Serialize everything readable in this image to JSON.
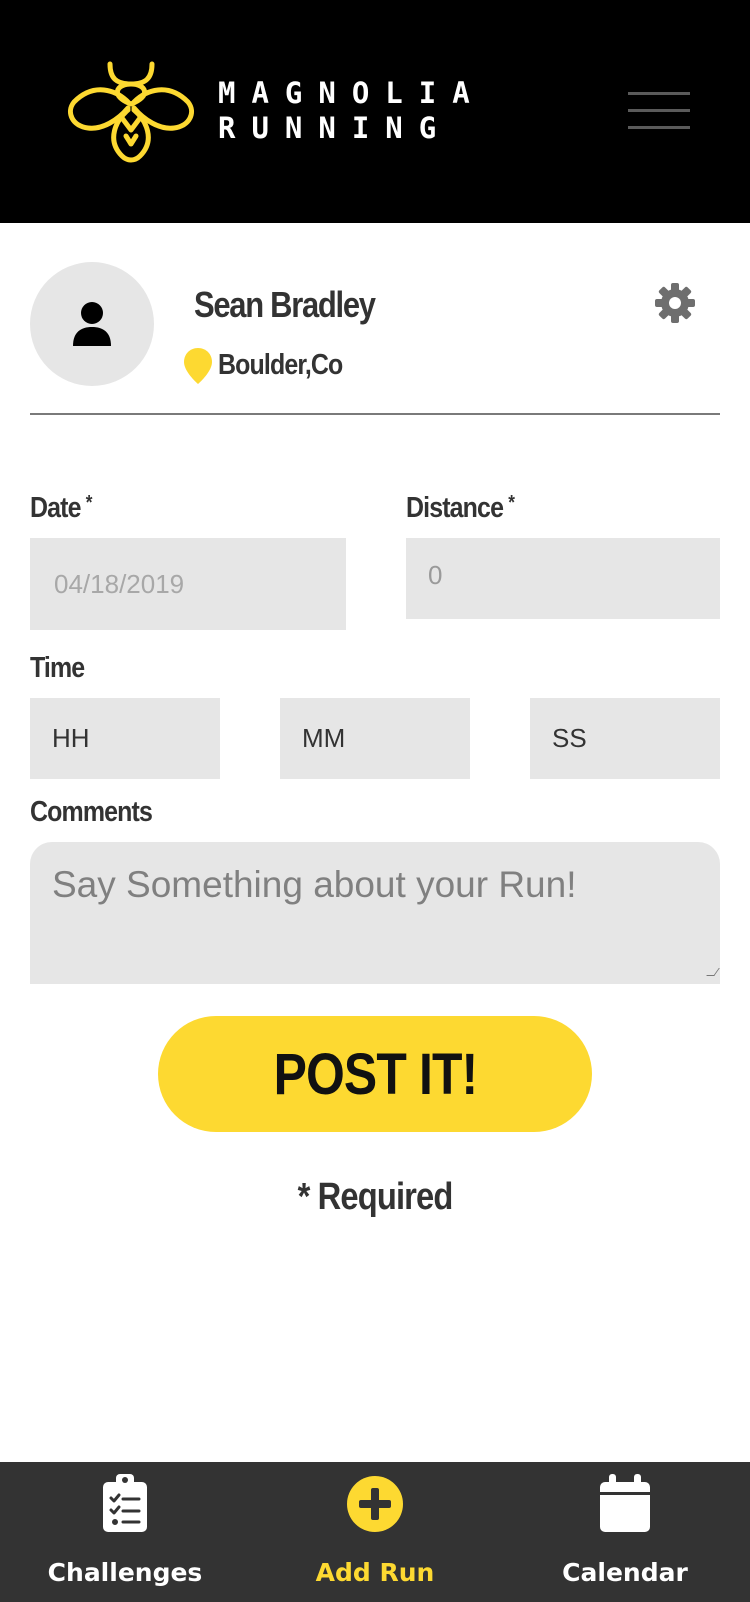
{
  "brand": {
    "line1": "MAGNOLIA",
    "line2": "RUNNING",
    "logo_icon": "bee-logo-icon",
    "accent": "#fdd931"
  },
  "header": {
    "menu_icon": "hamburger-menu-icon"
  },
  "profile": {
    "name": "Sean Bradley",
    "location": "Boulder,Co",
    "avatar_icon": "user-icon",
    "location_icon": "map-pin-icon",
    "settings_icon": "gear-icon"
  },
  "form": {
    "date_label": "Date",
    "date_value": "04/18/2019",
    "distance_label": "Distance",
    "distance_placeholder": "0",
    "required_mark": "*",
    "time_label": "Time",
    "hours_placeholder": "HH",
    "minutes_placeholder": "MM",
    "seconds_placeholder": "SS",
    "comments_label": "Comments",
    "comments_placeholder": "Say Something about your Run!",
    "submit_label": "POST IT!",
    "required_note": "* Required"
  },
  "bottom_nav": {
    "items": [
      {
        "label": "Challenges",
        "icon": "clipboard-checklist-icon",
        "active": false
      },
      {
        "label": "Add Run",
        "icon": "plus-circle-icon",
        "active": true
      },
      {
        "label": "Calendar",
        "icon": "calendar-icon",
        "active": false
      }
    ]
  }
}
